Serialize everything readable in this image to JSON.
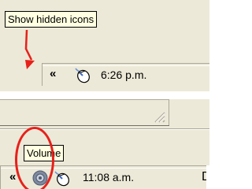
{
  "top": {
    "tooltip": "Show hidden icons",
    "chevron": "«",
    "clock": "6:26 p.m.",
    "icons": [
      "mouse-icon"
    ]
  },
  "bottom": {
    "tooltip": "Volume",
    "chevron": "«",
    "clock": "11:08 a.m.",
    "icons": [
      "volume-icon",
      "mouse-icon"
    ],
    "trailing_text": "D"
  },
  "colors": {
    "annotation": "#e8201a",
    "tooltip_bg": "#ffffe1",
    "taskbar": "#ece9d8"
  }
}
